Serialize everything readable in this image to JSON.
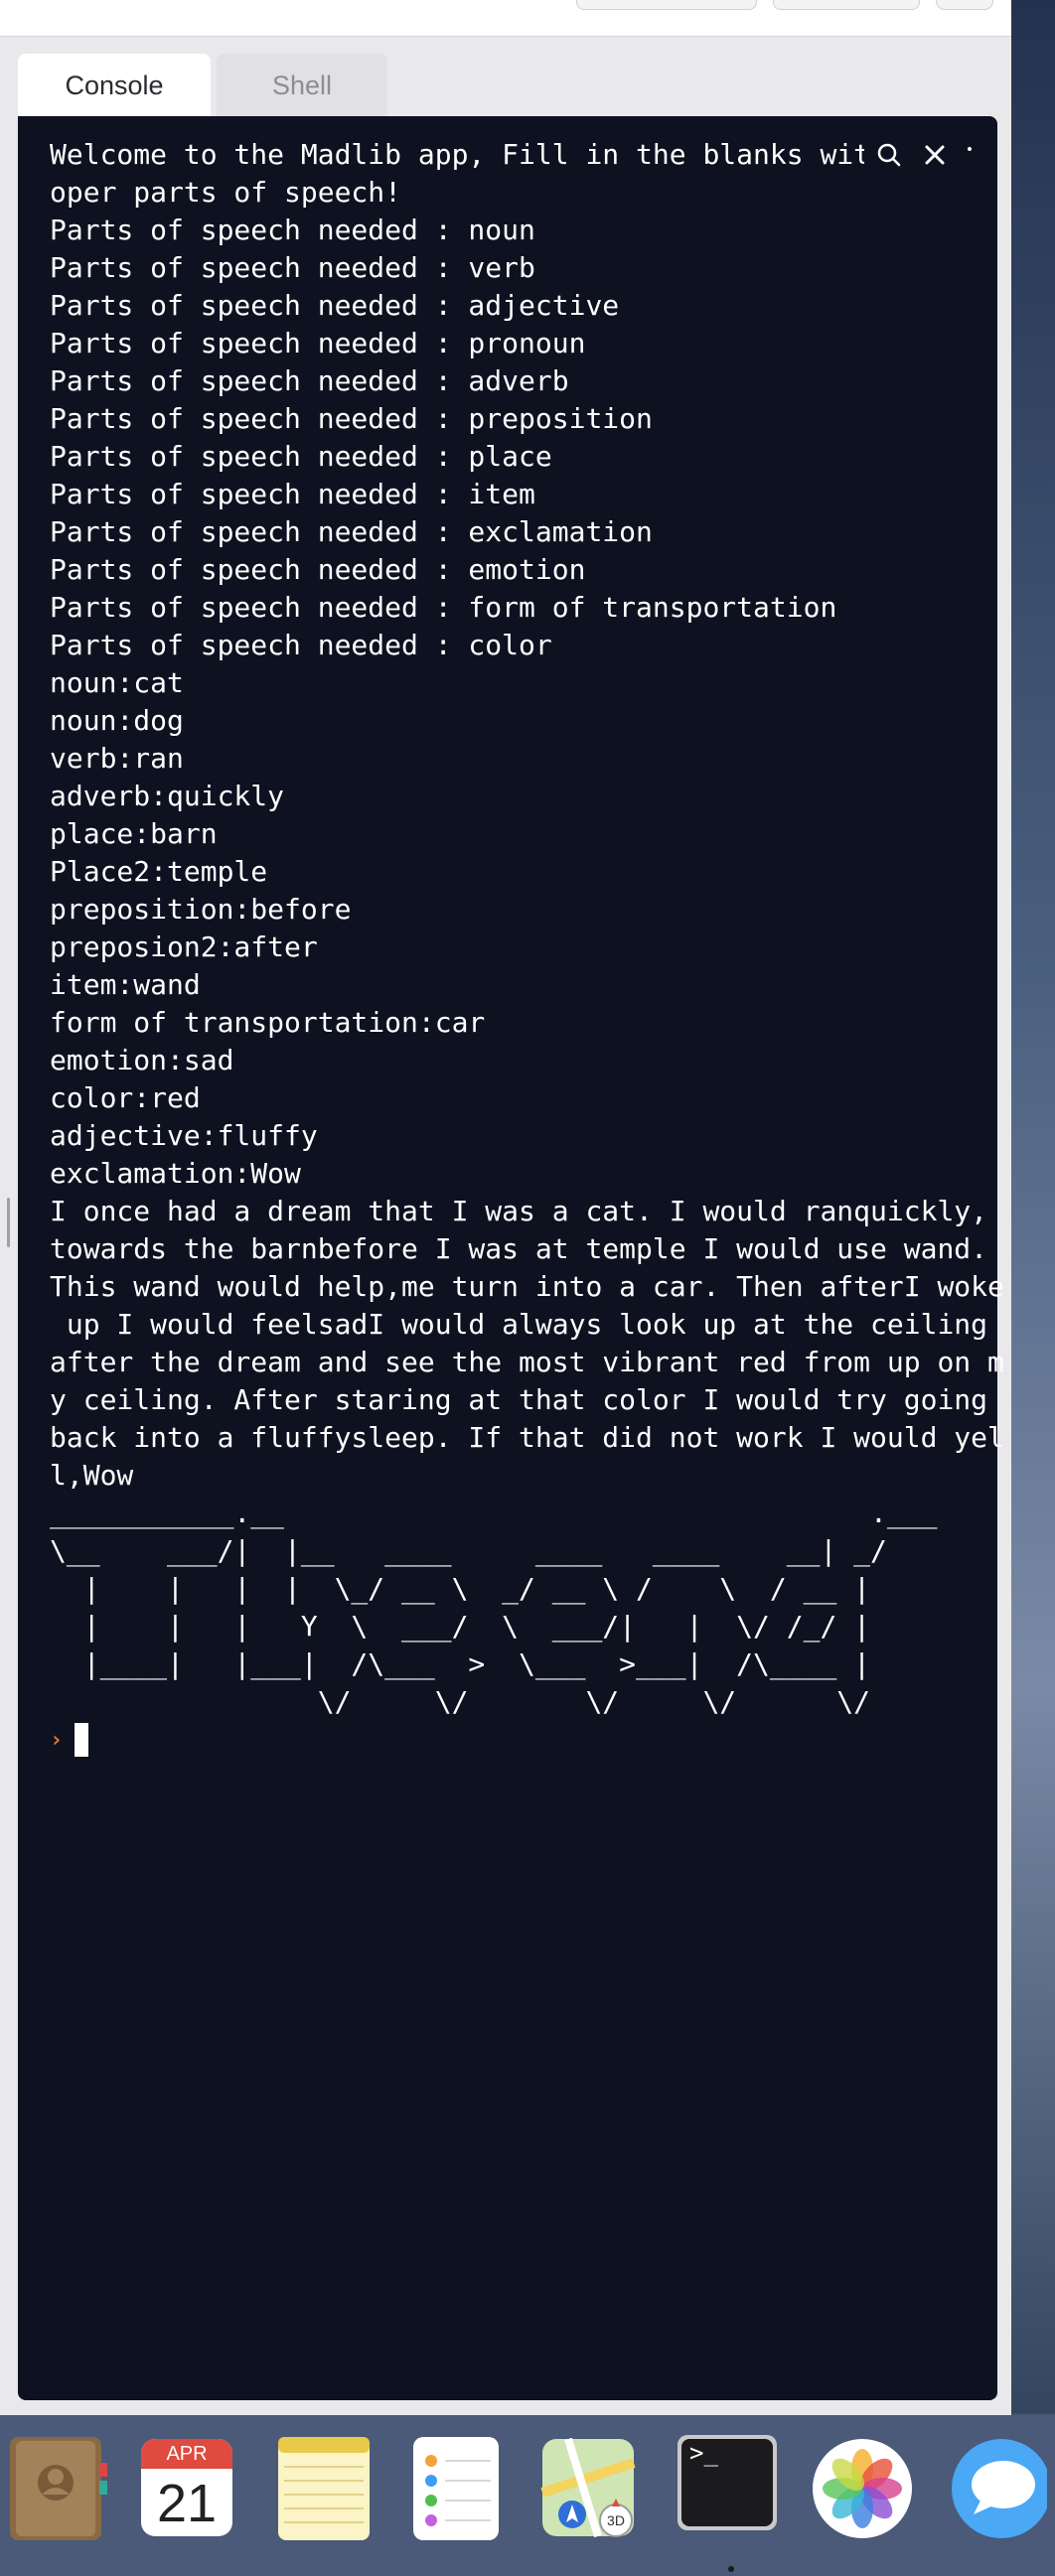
{
  "tabs": [
    {
      "label": "Console",
      "active": true
    },
    {
      "label": "Shell",
      "active": false
    }
  ],
  "console": {
    "lines": [
      "Welcome to the Madlib app, Fill in the blanks with pr",
      "oper parts of speech!",
      "Parts of speech needed : noun",
      "Parts of speech needed : verb",
      "Parts of speech needed : adjective",
      "Parts of speech needed : pronoun",
      "Parts of speech needed : adverb",
      "Parts of speech needed : preposition",
      "Parts of speech needed : place",
      "Parts of speech needed : item",
      "Parts of speech needed : exclamation",
      "Parts of speech needed : emotion",
      "Parts of speech needed : form of transportation",
      "Parts of speech needed : color",
      "noun:cat",
      "noun:dog",
      "verb:ran",
      "adverb:quickly",
      "place:barn",
      "Place2:temple",
      "preposition:before",
      "preposion2:after",
      "item:wand",
      "form of transportation:car",
      "emotion:sad",
      "color:red",
      "adjective:fluffy",
      "exclamation:Wow",
      "I once had a dream that I was a cat. I would ranquickly,",
      "towards the barnbefore I was at temple I would use wand.",
      "This wand would help,me turn into a car. Then afterI woke",
      " up I would feelsadI would always look up at the ceiling",
      "after the dream and see the most vibrant red from up on m",
      "y ceiling. After staring at that color I would try going",
      "back into a fluffysleep. If that did not work I would yel",
      "l,Wow",
      "___________.__                                   .___",
      "\\__    ___/|  |__   ____     ____   ____    __| _/",
      "  |    |   |  |  \\_/ __ \\  _/ __ \\ /    \\  / __ | ",
      "  |    |   |   Y  \\  ___/  \\  ___/|   |  \\/ /_/ | ",
      "  |____|   |___|  /\\___  >  \\___  >___|  /\\____ | ",
      "                \\/     \\/       \\/     \\/      \\/ "
    ],
    "prompt_symbol": "›"
  },
  "icons": {
    "search": "search-icon",
    "close": "close-icon",
    "more": "more-icon"
  },
  "dock": {
    "calendar_month": "APR",
    "calendar_day": "21",
    "apps": [
      "contacts",
      "calendar",
      "notes",
      "reminders",
      "maps",
      "terminal",
      "photos",
      "messages"
    ],
    "maps_badge": "3D",
    "terminal_glyph": ">_"
  }
}
